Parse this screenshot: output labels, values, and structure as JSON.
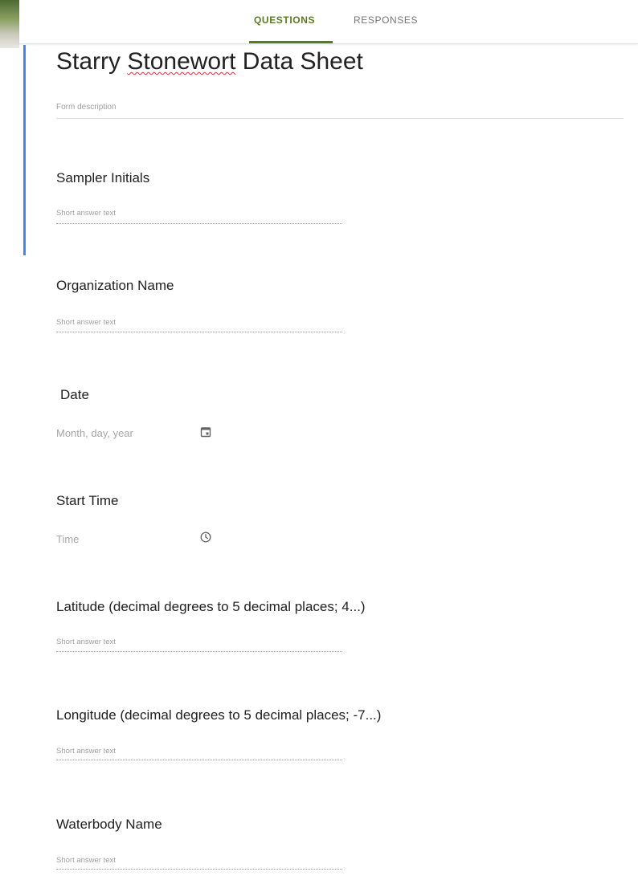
{
  "tabs": {
    "questions": "QUESTIONS",
    "responses": "RESPONSES"
  },
  "form": {
    "title_pre": "Starry ",
    "title_misspelled": "Stonewort",
    "title_post": " Data Sheet",
    "description_placeholder": "Form description"
  },
  "questions": [
    {
      "title": "Sampler Initials",
      "hint": "Short answer text"
    },
    {
      "title": "Organization Name",
      "hint": "Short answer text"
    },
    {
      "title": "Date",
      "hint": "Month, day, year",
      "icon": "calendar-icon"
    },
    {
      "title": "Start Time",
      "hint": "Time",
      "icon": "clock-icon"
    },
    {
      "title": "Latitude (decimal degrees to 5 decimal places;  4...)",
      "hint": "Short answer text"
    },
    {
      "title": "Longitude (decimal degrees to 5 decimal places;  -7...)",
      "hint": "Short answer text"
    },
    {
      "title": "Waterbody Name",
      "hint": "Short answer text"
    }
  ],
  "colors": {
    "accent": "#5b7b1f",
    "focus_bar": "#4285f4"
  }
}
